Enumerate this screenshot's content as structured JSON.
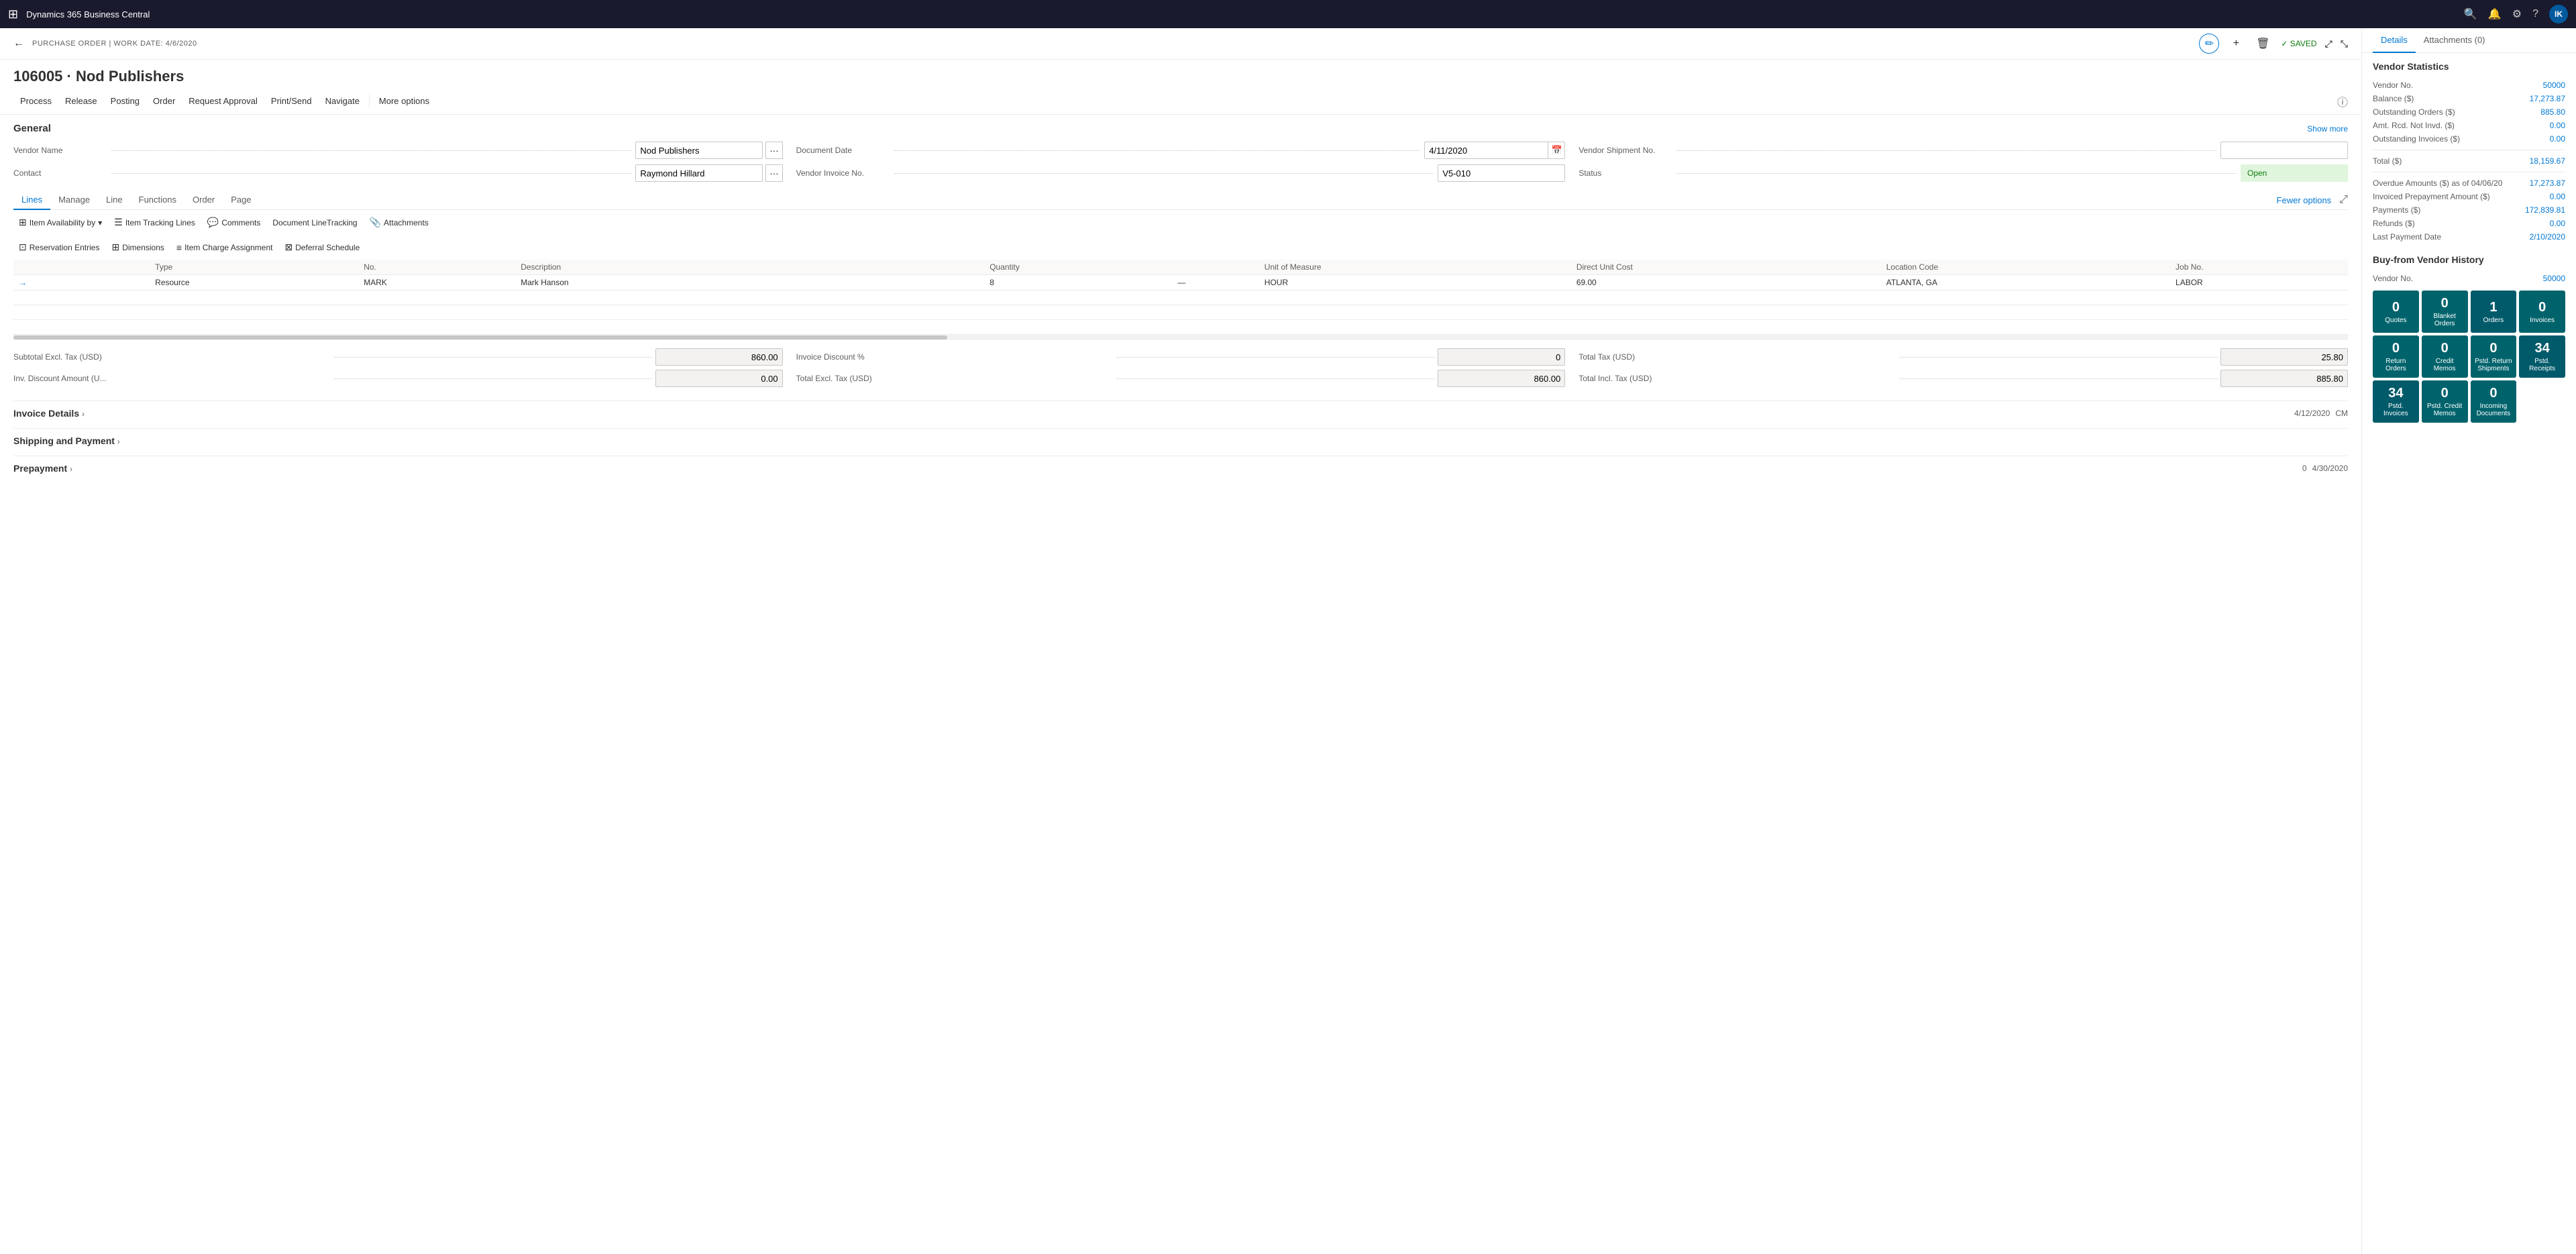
{
  "topNav": {
    "title": "Dynamics 365 Business Central",
    "icons": [
      "search",
      "bell",
      "settings",
      "help"
    ],
    "avatar": "IK"
  },
  "header": {
    "breadcrumb": "PURCHASE ORDER | WORK DATE: 4/6/2020",
    "savedLabel": "✓ SAVED",
    "editIcon": "✏",
    "plusIcon": "+",
    "deleteIcon": "🗑"
  },
  "pageTitle": "106005 · Nod Publishers",
  "commandBar": {
    "items": [
      "Process",
      "Release",
      "Posting",
      "Order",
      "Request Approval",
      "Print/Send",
      "Navigate"
    ],
    "moreOptions": "More options"
  },
  "general": {
    "sectionTitle": "General",
    "showMore": "Show more",
    "fields": {
      "vendorName": {
        "label": "Vendor Name",
        "value": "Nod Publishers"
      },
      "documentDate": {
        "label": "Document Date",
        "value": "4/11/2020"
      },
      "vendorShipmentNo": {
        "label": "Vendor Shipment No.",
        "value": ""
      },
      "contact": {
        "label": "Contact",
        "value": "Raymond Hillard"
      },
      "vendorInvoiceNo": {
        "label": "Vendor Invoice No.",
        "value": "V5-010"
      },
      "status": {
        "label": "Status",
        "value": "Open"
      }
    }
  },
  "lines": {
    "tabs": [
      "Lines",
      "Manage",
      "Line",
      "Functions",
      "Order",
      "Page"
    ],
    "activeTab": "Line",
    "fewerOptions": "Fewer options",
    "actions": [
      {
        "icon": "⊞",
        "label": "Item Availability by",
        "hasDropdown": true
      },
      {
        "icon": "☰",
        "label": "Item Tracking Lines"
      },
      {
        "icon": "💬",
        "label": "Comments"
      },
      {
        "icon": "📋",
        "label": "Document LineTracking"
      },
      {
        "icon": "📎",
        "label": "Attachments"
      },
      {
        "icon": "⊡",
        "label": "Reservation Entries"
      },
      {
        "icon": "⊞",
        "label": "Dimensions"
      },
      {
        "icon": "≡",
        "label": "Item Charge Assignment"
      },
      {
        "icon": "⊠",
        "label": "Deferral Schedule"
      }
    ],
    "columns": [
      "",
      "",
      "Type",
      "No.",
      "Description",
      "",
      "",
      "",
      "",
      "Quantity",
      "",
      "Unit of Measure",
      "Direct Unit Cost",
      "Location Code",
      "Job No."
    ],
    "rows": [
      {
        "arrow": "→",
        "type": "Resource",
        "no": "MARK",
        "description": "Mark Hanson",
        "quantity": "8",
        "dash": "—",
        "unitOfMeasure": "HOUR",
        "directUnitCost": "69.00",
        "locationCode": "ATLANTA, GA",
        "jobNo": "LABOR"
      }
    ],
    "totals": {
      "subtotalExclTax": {
        "label": "Subtotal Excl. Tax (USD)",
        "value": "860.00"
      },
      "invoiceDiscount": {
        "label": "Invoice Discount %",
        "value": "0"
      },
      "totalTax": {
        "label": "Total Tax (USD)",
        "value": "25.80"
      },
      "invDiscountAmount": {
        "label": "Inv. Discount Amount (U...",
        "value": "0.00"
      },
      "totalExclTax": {
        "label": "Total Excl. Tax (USD)",
        "value": "860.00"
      },
      "totalInclTax": {
        "label": "Total Incl. Tax (USD)",
        "value": "885.80"
      }
    }
  },
  "invoiceDetails": {
    "title": "Invoice Details",
    "meta1": "4/12/2020",
    "meta2": "CM"
  },
  "shippingPayment": {
    "title": "Shipping and Payment"
  },
  "prepayment": {
    "title": "Prepayment",
    "meta1": "0",
    "meta2": "4/30/2020"
  },
  "rightPanel": {
    "tabs": [
      "Details",
      "Attachments (0)"
    ],
    "activeTab": "Details",
    "vendorStats": {
      "title": "Vendor Statistics",
      "rows": [
        {
          "label": "Vendor No.",
          "value": "50000"
        },
        {
          "label": "Balance ($)",
          "value": "17,273.87"
        },
        {
          "label": "Outstanding Orders ($)",
          "value": "885.80"
        },
        {
          "label": "Amt. Rcd. Not Invd. ($)",
          "value": "0.00"
        },
        {
          "label": "Outstanding Invoices ($)",
          "value": "0.00"
        },
        {
          "label": "Total ($)",
          "value": "18,159.67"
        },
        {
          "label": "Overdue Amounts ($) as of 04/06/20",
          "value": "17,273.87"
        },
        {
          "label": "Invoiced Prepayment Amount ($)",
          "value": "0.00"
        },
        {
          "label": "Payments ($)",
          "value": "172,839.81"
        },
        {
          "label": "Refunds ($)",
          "value": "0.00"
        },
        {
          "label": "Last Payment Date",
          "value": "2/10/2020"
        }
      ]
    },
    "buyFromVendorHistory": {
      "title": "Buy-from Vendor History",
      "vendorNo": {
        "label": "Vendor No.",
        "value": "50000"
      },
      "tiles": [
        {
          "count": "0",
          "label": "Quotes"
        },
        {
          "count": "0",
          "label": "Blanket Orders"
        },
        {
          "count": "1",
          "label": "Orders"
        },
        {
          "count": "0",
          "label": "Invoices"
        },
        {
          "count": "0",
          "label": "Return Orders"
        },
        {
          "count": "0",
          "label": "Credit Memos"
        },
        {
          "count": "0",
          "label": "Pstd. Return Shipments"
        },
        {
          "count": "34",
          "label": "Pstd. Receipts"
        },
        {
          "count": "34",
          "label": "Pstd. Invoices"
        },
        {
          "count": "0",
          "label": "Pstd. Credit Memos"
        },
        {
          "count": "0",
          "label": "Incoming Documents"
        }
      ]
    }
  }
}
